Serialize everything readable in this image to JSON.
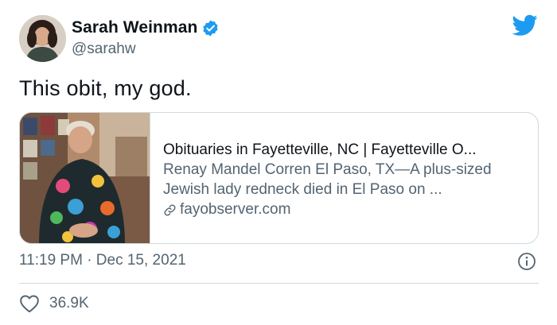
{
  "author": {
    "display_name": "Sarah Weinman",
    "handle": "@sarahw",
    "verified": true,
    "avatar_icon": "avatar"
  },
  "tweet": {
    "text": "This obit, my god.",
    "timestamp": "11:19 PM · Dec 15, 2021",
    "like_count": "36.9K"
  },
  "link_card": {
    "title": "Obituaries in Fayetteville, NC | Fayetteville O...",
    "description": "Renay Mandel Corren El Paso, TX—A plus-sized Jewish lady redneck died in El Paso on ...",
    "domain": "fayobserver.com"
  },
  "icons": {
    "brand": "twitter-bird-icon",
    "verified": "verified-badge-icon",
    "link": "link-icon",
    "info": "info-icon",
    "like": "heart-icon"
  },
  "colors": {
    "brand_blue": "#1d9bf0",
    "text_primary": "#0f1419",
    "text_secondary": "#536471",
    "border": "#cfd9de"
  }
}
